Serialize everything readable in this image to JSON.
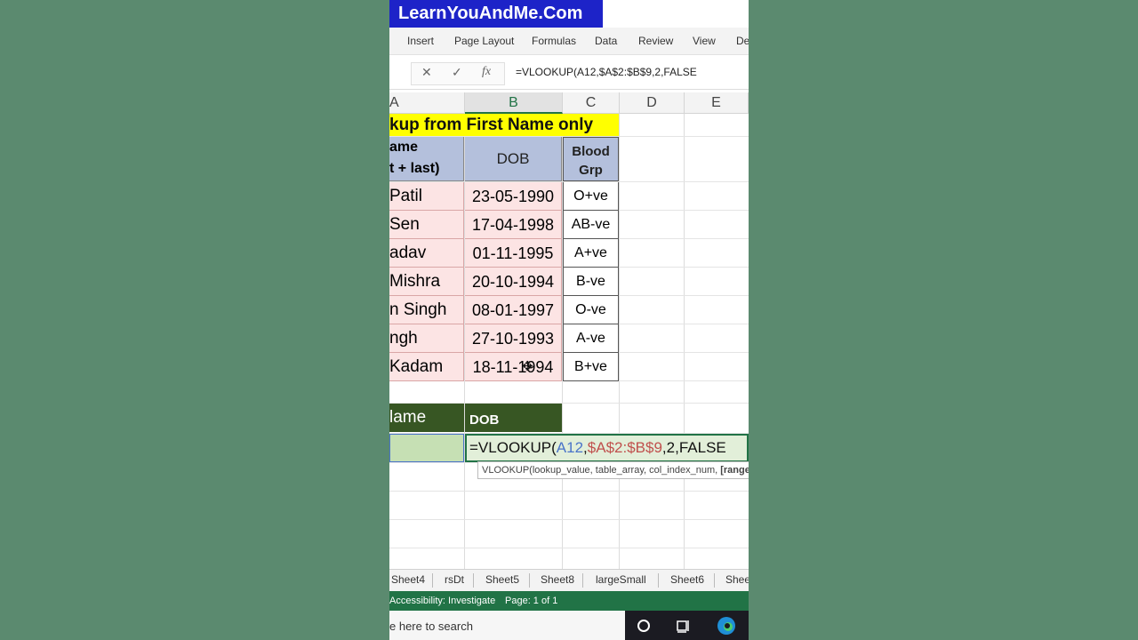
{
  "banner": "LearnYouAndMe.Com",
  "ribbon": {
    "tabs": [
      "Insert",
      "Page Layout",
      "Formulas",
      "Data",
      "Review",
      "View",
      "De"
    ]
  },
  "formula_bar": {
    "cancel": "✕",
    "enter": "✓",
    "fx": "fx",
    "formula": "=VLOOKUP(A12,$A$2:$B$9,2,FALSE"
  },
  "columns": [
    "A",
    "B",
    "C",
    "D",
    "E"
  ],
  "sheet": {
    "title": "kup from First Name only",
    "headers": {
      "a_line1": "ame",
      "a_line2": "t + last)",
      "b": "DOB",
      "c_line1": "Blood",
      "c_line2": "Grp"
    },
    "rows": [
      {
        "name": "Patil",
        "dob": "23-05-1990",
        "blood": "O+ve"
      },
      {
        "name": "Sen",
        "dob": "17-04-1998",
        "blood": "AB-ve"
      },
      {
        "name": "adav",
        "dob": "01-11-1995",
        "blood": "A+ve"
      },
      {
        "name": "Mishra",
        "dob": "20-10-1994",
        "blood": "B-ve"
      },
      {
        "name": "n Singh",
        "dob": "08-01-1997",
        "blood": "O-ve"
      },
      {
        "name": "ngh",
        "dob": "27-10-1993",
        "blood": "A-ve"
      },
      {
        "name": "Kadam",
        "dob": "18-11-1994",
        "blood": "B+ve"
      }
    ],
    "lookup_headers": {
      "name": "lame",
      "dob": "DOB"
    },
    "edit_formula": {
      "prefix": "=VLOOKUP(",
      "arg1": "A12",
      "comma1": ",",
      "arg2": "$A$2:$B$9",
      "rest": ",2,FALSE"
    },
    "tooltip": {
      "text": "VLOOKUP(lookup_value, table_array, col_index_num, ",
      "bold": "[range"
    }
  },
  "sheet_tabs": [
    "Sheet4",
    "rsDt",
    "Sheet5",
    "Sheet8",
    "largeSmall",
    "Sheet6",
    "Shee"
  ],
  "status_bar": {
    "accessibility": "Accessibility: Investigate",
    "page": "Page: 1 of 1"
  },
  "taskbar": {
    "search_placeholder": "e here to search"
  },
  "colors": {
    "banner": "#1d23c8",
    "title_fill": "#ffff00",
    "header_fill": "#b4c0dc",
    "row_fill": "#fce4e4",
    "lookup_fill": "#375623",
    "status": "#217346",
    "ref_blue": "#4a74c9",
    "ref_red": "#c0504d"
  }
}
